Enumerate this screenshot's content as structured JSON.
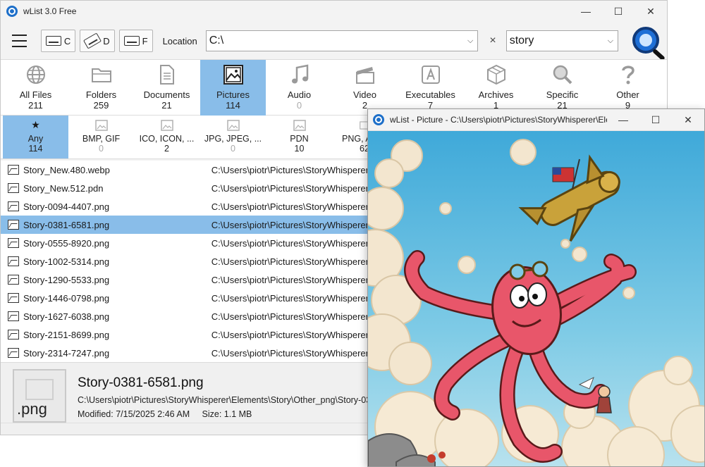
{
  "window": {
    "title": "wList 3.0 Free",
    "minimize": "—",
    "maximize": "☐",
    "close": "✕"
  },
  "toolbar": {
    "drives": [
      {
        "label": "C"
      },
      {
        "label": "D"
      },
      {
        "label": "F"
      }
    ],
    "location_label": "Location",
    "location_value": "C:\\",
    "clear_label": "×",
    "search_value": "story"
  },
  "categories": [
    {
      "label": "All Files",
      "count": "211",
      "icon": "globe-icon"
    },
    {
      "label": "Folders",
      "count": "259",
      "icon": "folder-icon"
    },
    {
      "label": "Documents",
      "count": "21",
      "icon": "document-icon"
    },
    {
      "label": "Pictures",
      "count": "114",
      "icon": "picture-icon",
      "selected": true
    },
    {
      "label": "Audio",
      "count": "0",
      "icon": "music-icon"
    },
    {
      "label": "Video",
      "count": "2",
      "icon": "clapper-icon"
    },
    {
      "label": "Executables",
      "count": "7",
      "icon": "app-icon"
    },
    {
      "label": "Archives",
      "count": "1",
      "icon": "box-icon"
    },
    {
      "label": "Specific",
      "count": "21",
      "icon": "magnifier-icon"
    },
    {
      "label": "Other",
      "count": "9",
      "icon": "question-icon"
    }
  ],
  "subfilters": [
    {
      "label": "Any",
      "count": "114",
      "selected": true
    },
    {
      "label": "BMP, GIF",
      "count": "0"
    },
    {
      "label": "ICO, ICON, ...",
      "count": "2"
    },
    {
      "label": "JPG, JPEG, ...",
      "count": "0"
    },
    {
      "label": "PDN",
      "count": "10"
    },
    {
      "label": "PNG, A",
      "count": "62"
    }
  ],
  "files": [
    {
      "name": "Story_New.480.webp",
      "path": "C:\\Users\\piotr\\Pictures\\StoryWhisperer"
    },
    {
      "name": "Story_New.512.pdn",
      "path": "C:\\Users\\piotr\\Pictures\\StoryWhisperer"
    },
    {
      "name": "Story-0094-4407.png",
      "path": "C:\\Users\\piotr\\Pictures\\StoryWhisperer"
    },
    {
      "name": "Story-0381-6581.png",
      "path": "C:\\Users\\piotr\\Pictures\\StoryWhisperer",
      "selected": true
    },
    {
      "name": "Story-0555-8920.png",
      "path": "C:\\Users\\piotr\\Pictures\\StoryWhisperer"
    },
    {
      "name": "Story-1002-5314.png",
      "path": "C:\\Users\\piotr\\Pictures\\StoryWhisperer"
    },
    {
      "name": "Story-1290-5533.png",
      "path": "C:\\Users\\piotr\\Pictures\\StoryWhisperer"
    },
    {
      "name": "Story-1446-0798.png",
      "path": "C:\\Users\\piotr\\Pictures\\StoryWhisperer"
    },
    {
      "name": "Story-1627-6038.png",
      "path": "C:\\Users\\piotr\\Pictures\\StoryWhisperer"
    },
    {
      "name": "Story-2151-8699.png",
      "path": "C:\\Users\\piotr\\Pictures\\StoryWhisperer"
    },
    {
      "name": "Story-2314-7247.png",
      "path": "C:\\Users\\piotr\\Pictures\\StoryWhisperer"
    }
  ],
  "details": {
    "ext": ".png",
    "name": "Story-0381-6581.png",
    "path": "C:\\Users\\piotr\\Pictures\\StoryWhisperer\\Elements\\Story\\Other_png\\Story-03",
    "modified": "Modified: 7/15/2025 2:46 AM",
    "size": "Size: 1.1 MB"
  },
  "preview": {
    "title": "wList - Picture - C:\\Users\\piotr\\Pictures\\StoryWhisperer\\Ele...",
    "minimize": "—",
    "maximize": "☐",
    "close": "✕"
  },
  "colors": {
    "selection": "#89bde9",
    "accent": "#1e6fd6"
  }
}
